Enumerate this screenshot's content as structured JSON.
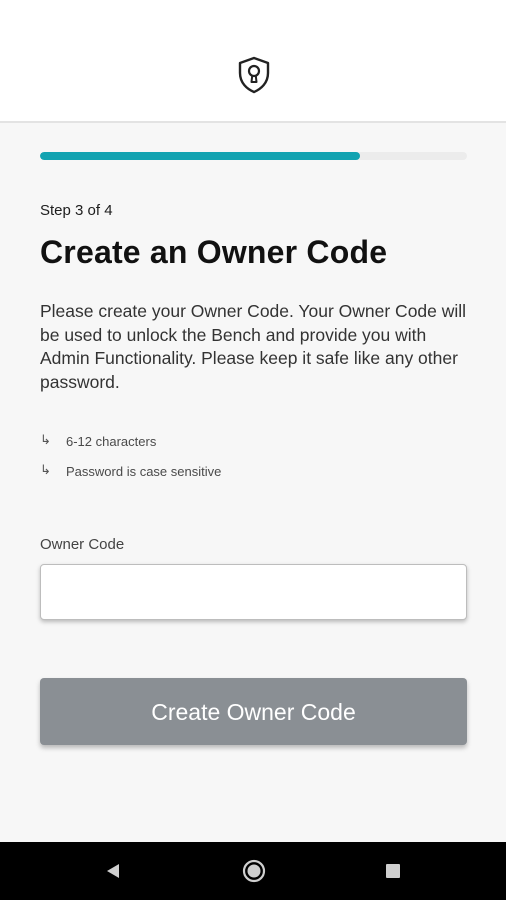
{
  "header": {
    "logo_icon": "shield-keyhole-icon"
  },
  "progress": {
    "fraction": 0.75,
    "color": "#12a3b1"
  },
  "step_text": "Step 3 of 4",
  "title": "Create an Owner Code",
  "description": "Please create your Owner Code. Your Owner Code will be used to unlock the Bench and provide you with Admin Functionality. Please keep it safe like any other password.",
  "requirements": [
    {
      "icon": "return-arrow-icon",
      "arrow": "↳",
      "text": "6-12 characters"
    },
    {
      "icon": "return-arrow-icon",
      "arrow": "↳",
      "text": "Password is case sensitive"
    }
  ],
  "owner_code": {
    "label": "Owner Code",
    "value": "",
    "placeholder": ""
  },
  "submit_button": {
    "label": "Create Owner Code",
    "color": "#8a8f94"
  },
  "navbar": {
    "back_icon": "back-triangle-icon",
    "home_icon": "home-circle-icon",
    "recent_icon": "recent-square-icon"
  }
}
